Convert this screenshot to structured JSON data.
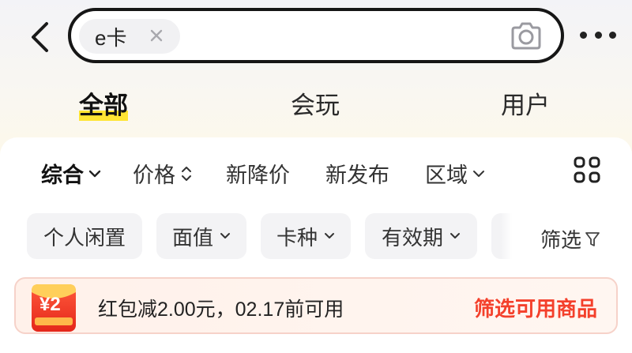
{
  "search": {
    "keyword_chip": "e卡"
  },
  "icons": {
    "back": "chevron-left-icon",
    "clear": "close-icon",
    "camera": "camera-icon",
    "more": "more-icon",
    "grid": "grid-icon",
    "filter": "funnel-icon",
    "coupon": "red-envelope-icon"
  },
  "tabs": [
    {
      "label": "全部",
      "active": true
    },
    {
      "label": "会玩",
      "active": false
    },
    {
      "label": "用户",
      "active": false
    }
  ],
  "sort_bar": [
    {
      "label": "综合",
      "active": true
    },
    {
      "label": "价格"
    },
    {
      "label": "新降价"
    },
    {
      "label": "新发布"
    },
    {
      "label": "区域"
    }
  ],
  "filters": [
    {
      "label": "个人闲置"
    },
    {
      "label": "面值"
    },
    {
      "label": "卡种"
    },
    {
      "label": "有效期"
    }
  ],
  "filter_button": "筛选",
  "coupon": {
    "amount": "¥2",
    "text": "红包减2.00元，02.17前可用",
    "action": "筛选可用商品"
  },
  "colors": {
    "accent_yellow": "#ffe533",
    "coupon_red": "#f4402b"
  }
}
